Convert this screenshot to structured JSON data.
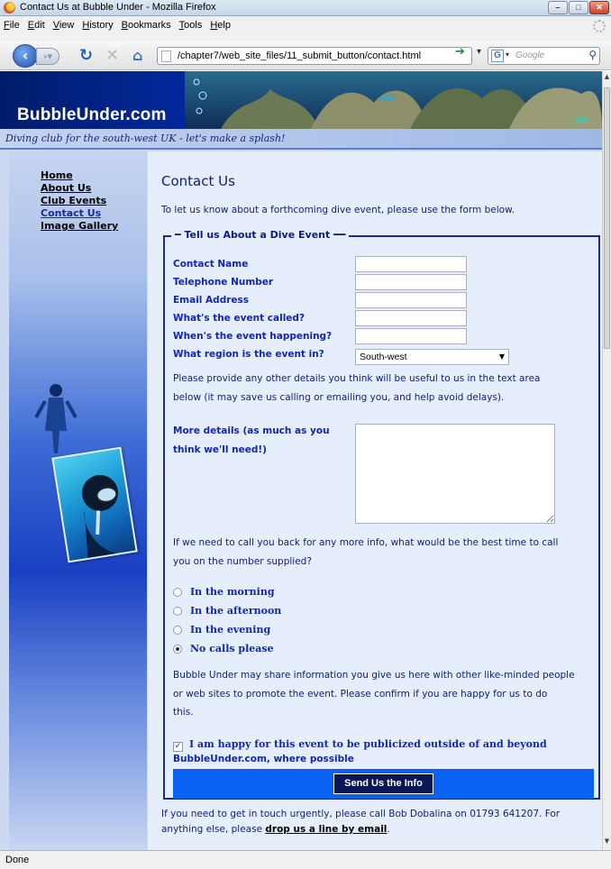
{
  "browser": {
    "window_title": "Contact Us at Bubble Under - Mozilla Firefox",
    "menu": [
      "File",
      "Edit",
      "View",
      "History",
      "Bookmarks",
      "Tools",
      "Help"
    ],
    "url": "/chapter7/web_site_files/11_submit_button/contact.html",
    "search_placeholder": "Google",
    "status": "Done"
  },
  "site": {
    "name": "BubbleUnder.com",
    "tagline": "Diving club for the south-west UK - let's make a splash!"
  },
  "nav": {
    "items": [
      {
        "label": "Home"
      },
      {
        "label": "About Us"
      },
      {
        "label": "Club Events"
      },
      {
        "label": "Contact Us"
      },
      {
        "label": "Image Gallery"
      }
    ],
    "current": "Contact Us"
  },
  "page": {
    "title": "Contact Us",
    "intro": "To let us know about a forthcoming dive event, please use the form below."
  },
  "form": {
    "legend": "Tell us About a Dive Event",
    "fields": {
      "contact_name": {
        "label": "Contact Name",
        "value": ""
      },
      "telephone": {
        "label": "Telephone Number",
        "value": ""
      },
      "email": {
        "label": "Email Address",
        "value": ""
      },
      "event_name": {
        "label": "What's the event called?",
        "value": ""
      },
      "event_date": {
        "label": "When's the event happening?",
        "value": ""
      },
      "region": {
        "label": "What region is the event in?",
        "value": "South-west"
      }
    },
    "details_intro": "Please provide any other details you think will be useful to us in the text area below (it may save us calling or emailing you, and help avoid delays).",
    "details_intro_line1": "Please provide any other details you think will be useful to us in the text area",
    "details_intro_line2": "below (it may save us calling or emailing you, and help avoid delays).",
    "details_label_line1": "More details (as much as you",
    "details_label_line2": "think we'll need!)",
    "callback_line1": "If we need to call you back for any more info, what would be the best time to call",
    "callback_line2": "you on the number supplied?",
    "call_options": [
      {
        "label": "In the morning",
        "selected": false
      },
      {
        "label": "In the afternoon",
        "selected": false
      },
      {
        "label": "In the evening",
        "selected": false
      },
      {
        "label": "No calls please",
        "selected": true
      }
    ],
    "share_line1": "Bubble Under may share information you give us here with other like-minded people",
    "share_line2": "or web sites to promote the event. Please confirm if you are happy for us to do",
    "share_line3": "this.",
    "publicize_label_line1": "I am happy for this event to be publicized outside of and beyond",
    "publicize_label_line2": "BubbleUnder.com, where possible",
    "publicize_checked": true,
    "submit_label": "Send Us the Info"
  },
  "footer": {
    "text_line1": "If you need to get in touch urgently, please call Bob Dobalina on 01793 641207. For",
    "text_line2_prefix": "anything else, please ",
    "email_link": "drop us a line by email",
    "text_line2_suffix": "."
  },
  "colors": {
    "heading_blue": "#0f1d78",
    "label_blue": "#1126b3",
    "submit_bar": "#0962f2",
    "submit_button": "#0a1553",
    "content_bg": "#e6eefc"
  }
}
